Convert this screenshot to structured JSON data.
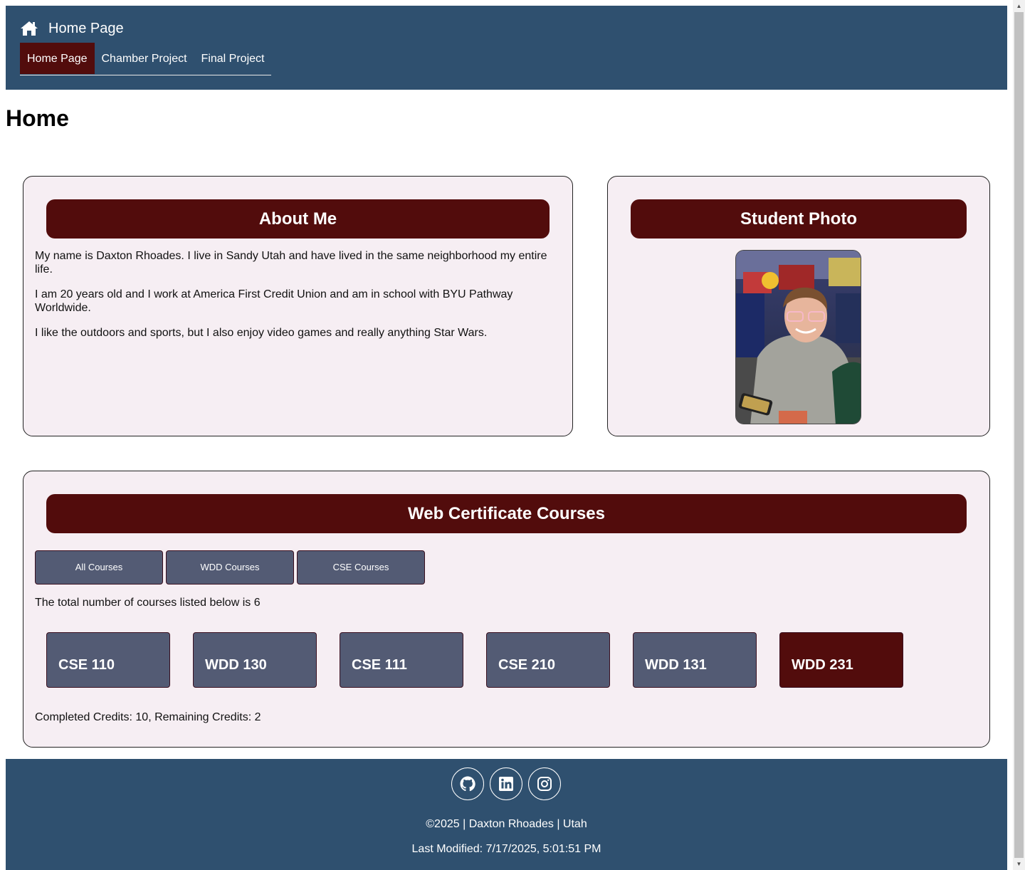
{
  "header": {
    "title": "Home Page",
    "nav": [
      {
        "label": "Home Page",
        "active": true
      },
      {
        "label": "Chamber Project",
        "active": false
      },
      {
        "label": "Final Project",
        "active": false
      }
    ]
  },
  "page_title": "Home",
  "about": {
    "heading": "About Me",
    "paragraphs": [
      "My name is Daxton Rhoades. I live in Sandy Utah and have lived in the same neighborhood my entire life.",
      "I am 20 years old and I work at America First Credit Union and am in school with BYU Pathway Worldwide.",
      "I like the outdoors and sports, but I also enjoy video games and really anything Star Wars."
    ]
  },
  "photo": {
    "heading": "Student Photo"
  },
  "courses": {
    "heading": "Web Certificate Courses",
    "filters": [
      "All Courses",
      "WDD Courses",
      "CSE Courses"
    ],
    "count_text": "The total number of courses listed below is 6",
    "items": [
      {
        "code": "CSE 110",
        "completed": false
      },
      {
        "code": "WDD 130",
        "completed": false
      },
      {
        "code": "CSE 111",
        "completed": false
      },
      {
        "code": "CSE 210",
        "completed": false
      },
      {
        "code": "WDD 131",
        "completed": false
      },
      {
        "code": "WDD 231",
        "completed": true
      }
    ],
    "credits_text": "Completed Credits: 10, Remaining Credits: 2"
  },
  "footer": {
    "social": [
      "github-icon",
      "linkedin-icon",
      "instagram-icon"
    ],
    "copyright": "©2025 | Daxton Rhoades | Utah",
    "last_modified": "Last Modified: 7/17/2025, 5:01:51 PM"
  },
  "colors": {
    "header_bg": "#2f506f",
    "accent_maroon": "#520c0c",
    "course_slate": "#535b74",
    "card_bg": "#f6eef3"
  }
}
